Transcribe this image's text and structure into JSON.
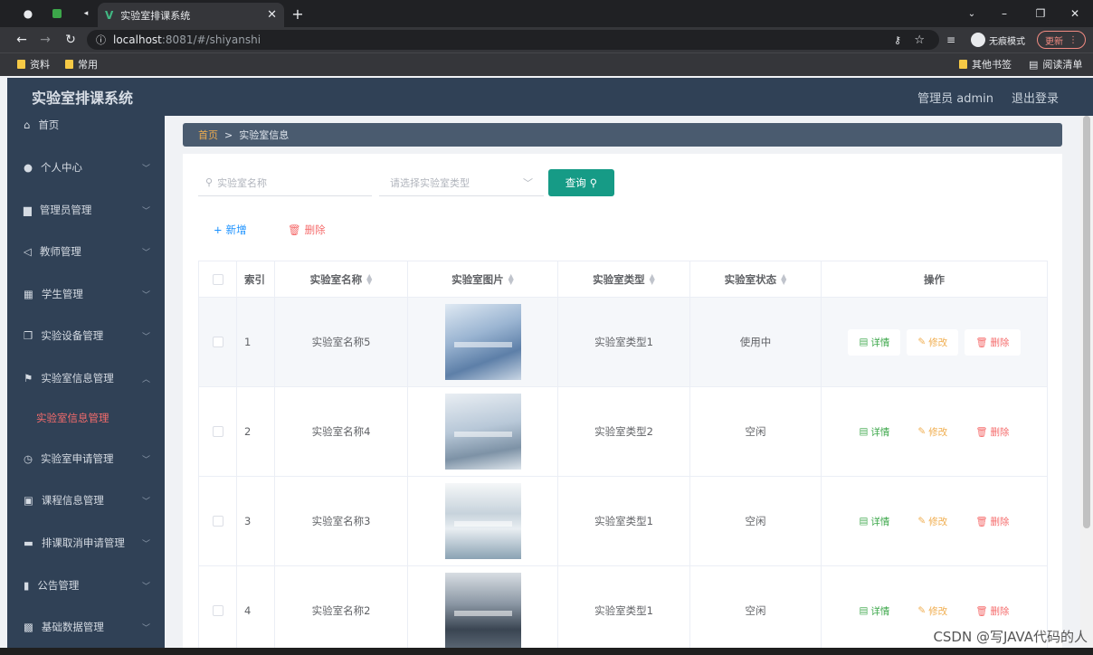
{
  "browser": {
    "tab_title": "实验室排课系统",
    "url_host": "localhost",
    "url_rest": ":8081/#/shiyanshi",
    "incognito_label": "无痕模式",
    "update_label": "更新",
    "bookmarks": [
      "资料",
      "常用"
    ],
    "other_bookmarks": "其他书签",
    "reading_list": "阅读清单"
  },
  "header": {
    "title": "实验室排课系统",
    "user": "管理员 admin",
    "logout": "退出登录"
  },
  "sidebar": {
    "items": [
      {
        "label": "首页"
      },
      {
        "label": "个人中心"
      },
      {
        "label": "管理员管理"
      },
      {
        "label": "教师管理"
      },
      {
        "label": "学生管理"
      },
      {
        "label": "实验设备管理"
      },
      {
        "label": "实验室信息管理"
      },
      {
        "label": "实验室信息管理"
      },
      {
        "label": "实验室申请管理"
      },
      {
        "label": "课程信息管理"
      },
      {
        "label": "排课取消申请管理"
      },
      {
        "label": "公告管理"
      },
      {
        "label": "基础数据管理"
      }
    ]
  },
  "breadcrumb": {
    "home": "首页",
    "sep": ">",
    "current": "实验室信息"
  },
  "search": {
    "name_placeholder": "实验室名称",
    "type_placeholder": "请选择实验室类型",
    "query_label": "查询"
  },
  "actions": {
    "add": "新增",
    "delete": "删除"
  },
  "table": {
    "headers": [
      "索引",
      "实验室名称",
      "实验室图片",
      "实验室类型",
      "实验室状态",
      "操作"
    ],
    "row_actions": {
      "detail": "详情",
      "edit": "修改",
      "delete": "删除"
    },
    "rows": [
      {
        "index": "1",
        "name": "实验室名称5",
        "type": "实验室类型1",
        "status": "使用中"
      },
      {
        "index": "2",
        "name": "实验室名称4",
        "type": "实验室类型2",
        "status": "空闲"
      },
      {
        "index": "3",
        "name": "实验室名称3",
        "type": "实验室类型1",
        "status": "空闲"
      },
      {
        "index": "4",
        "name": "实验室名称2",
        "type": "实验室类型1",
        "status": "空闲"
      }
    ]
  },
  "watermark": "CSDN @写JAVA代码的人",
  "colors": {
    "sidebar": "#304156",
    "accent": "#169b86",
    "danger": "#f56c6c"
  }
}
